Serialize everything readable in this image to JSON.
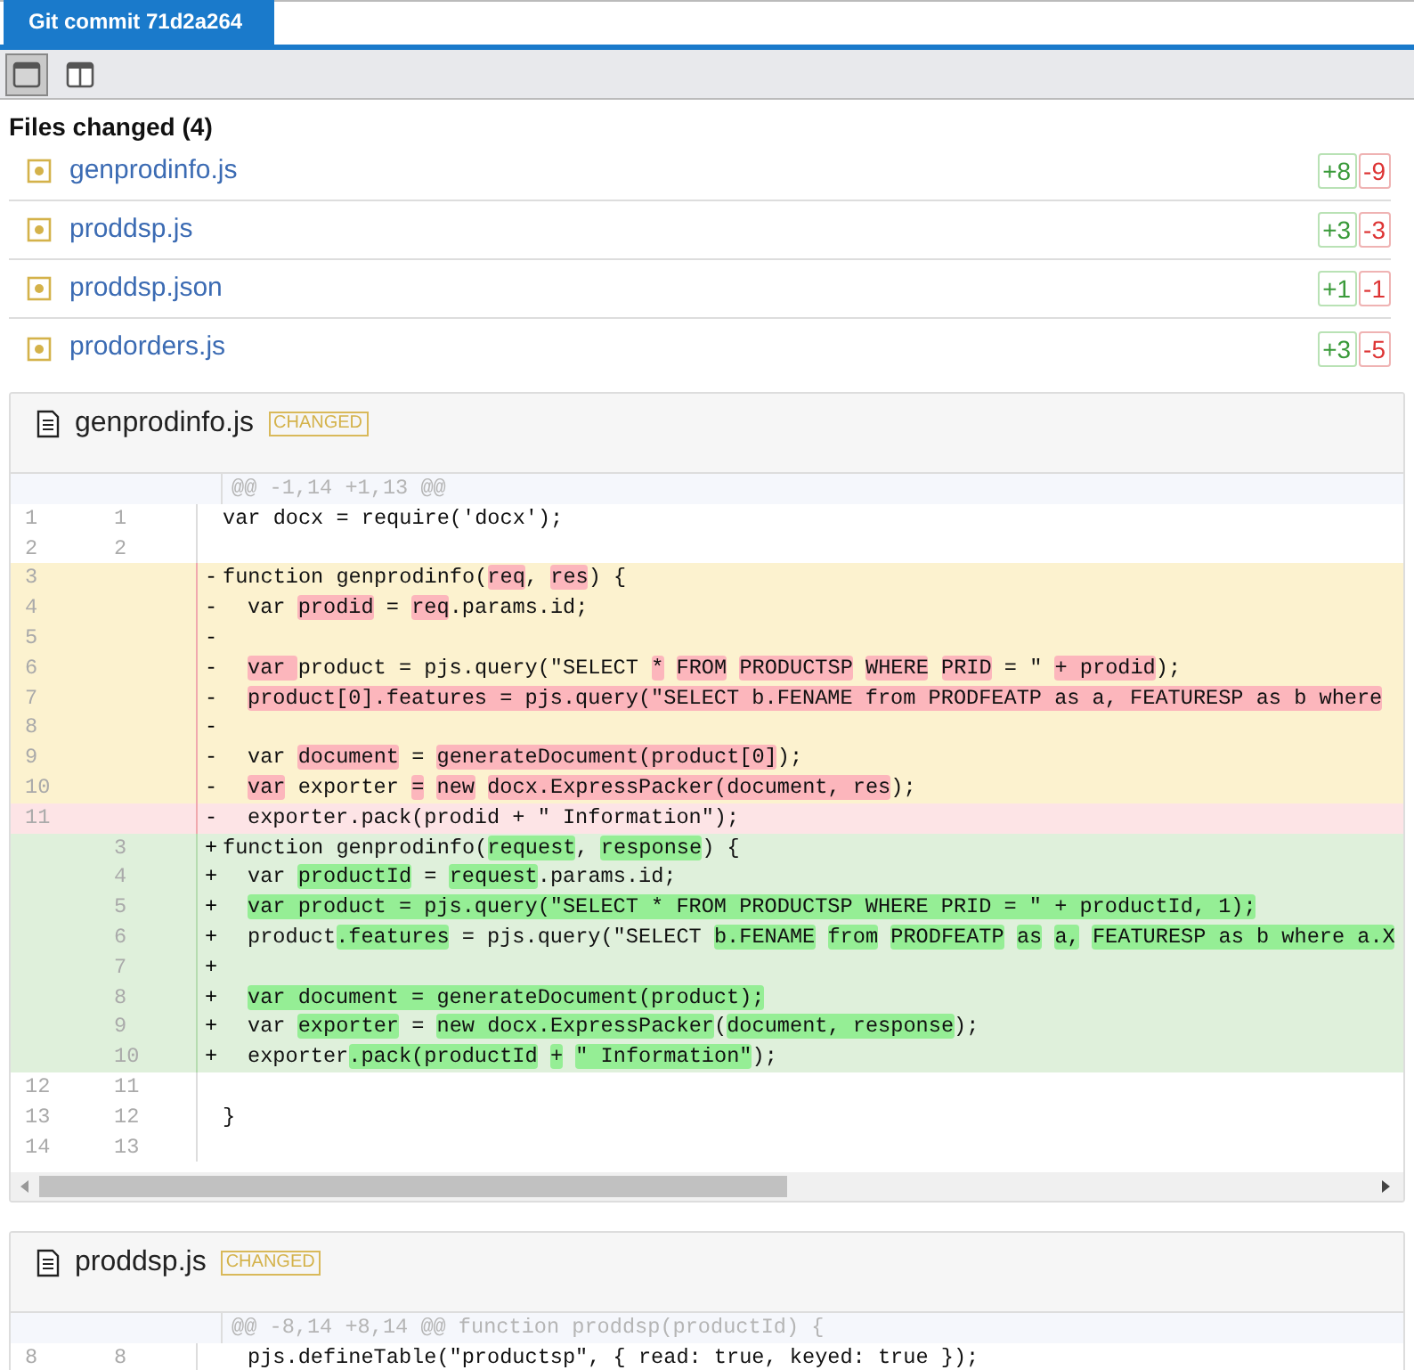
{
  "tab": {
    "label": "Git commit 71d2a264",
    "selected": true
  },
  "view_modes": [
    {
      "kind": "unified",
      "selected": true
    },
    {
      "kind": "split",
      "selected": false
    }
  ],
  "files_heading": "Files changed (4)",
  "files": [
    {
      "name": "genprodinfo.js",
      "added": "+8",
      "removed": "-9"
    },
    {
      "name": "proddsp.js",
      "added": "+3",
      "removed": "-3"
    },
    {
      "name": "proddsp.json",
      "added": "+1",
      "removed": "-1"
    },
    {
      "name": "prodorders.js",
      "added": "+3",
      "removed": "-5"
    }
  ],
  "diffs": [
    {
      "name": "genprodinfo.js",
      "status": "CHANGED",
      "hunk": "@@ -1,14 +1,13 @@",
      "scrollbar": true,
      "lines": [
        {
          "kind": "context",
          "old": "1",
          "new": "1",
          "code": [
            {
              "t": "var docx = require('docx');",
              "hl": false
            }
          ]
        },
        {
          "kind": "context",
          "old": "2",
          "new": "2"
        },
        {
          "kind": "modified",
          "old": "3",
          "marker": "-",
          "code": [
            {
              "t": "function genprodinfo(",
              "hl": false
            },
            {
              "t": "req",
              "hl": true
            },
            {
              "t": ",",
              "hl": false,
              "sp": true
            },
            {
              "t": "res",
              "hl": true
            },
            {
              "t": ") {",
              "hl": false
            }
          ]
        },
        {
          "kind": "modified",
          "old": "4",
          "marker": "-",
          "indented": true,
          "code": [
            {
              "t": "var",
              "hl": false,
              "sp": true
            },
            {
              "t": "prodid",
              "hl": true
            },
            {
              "t": " =",
              "hl": false,
              "sp": true
            },
            {
              "t": "req",
              "hl": true
            },
            {
              "t": ".params.id;",
              "hl": false
            }
          ]
        },
        {
          "kind": "modified",
          "old": "5",
          "marker": "-"
        },
        {
          "kind": "modified",
          "old": "6",
          "marker": "-",
          "indented": true,
          "code": [
            {
              "t": "var ",
              "hl": true
            },
            {
              "t": "product = pjs.query(\"SELECT",
              "hl": false,
              "sp": true
            },
            {
              "t": "*",
              "hl": true,
              "sp": true
            },
            {
              "t": "FROM",
              "hl": true,
              "sp": true
            },
            {
              "t": "PRODUCTSP",
              "hl": true,
              "sp": true
            },
            {
              "t": "WHERE",
              "hl": true,
              "sp": true
            },
            {
              "t": "PRID",
              "hl": true
            },
            {
              "t": " = \"",
              "hl": false,
              "sp": true
            },
            {
              "t": "+ prodid",
              "hl": true
            },
            {
              "t": ");",
              "hl": false
            }
          ]
        },
        {
          "kind": "modified",
          "old": "7",
          "marker": "-",
          "indented": true,
          "code": [
            {
              "t": "product[0].features = pjs.query(\"SELECT b.FENAME from PRODFEATP as a, FEATURESP as b where",
              "hl": true
            }
          ]
        },
        {
          "kind": "modified",
          "old": "8",
          "marker": "-"
        },
        {
          "kind": "modified",
          "old": "9",
          "marker": "-",
          "indented": true,
          "code": [
            {
              "t": "var",
              "hl": false,
              "sp": true
            },
            {
              "t": "document",
              "hl": true
            },
            {
              "t": " =",
              "hl": false,
              "sp": true
            },
            {
              "t": "generateDocument(product[0]",
              "hl": true
            },
            {
              "t": ");",
              "hl": false
            }
          ]
        },
        {
          "kind": "modified",
          "old": "10",
          "marker": "-",
          "indented": true,
          "code": [
            {
              "t": "var",
              "hl": true
            },
            {
              "t": " exporter",
              "hl": false,
              "sp": true
            },
            {
              "t": "=",
              "hl": true,
              "sp": true
            },
            {
              "t": "new",
              "hl": true,
              "sp": true
            },
            {
              "t": "docx.ExpressPacker(document, res",
              "hl": true
            },
            {
              "t": ");",
              "hl": false
            }
          ]
        },
        {
          "kind": "removed",
          "old": "11",
          "marker": "-",
          "indented": true,
          "code": [
            {
              "t": "exporter.pack(prodid + \" Information\");",
              "hl": false
            }
          ]
        },
        {
          "kind": "added",
          "new": "3",
          "marker": "+",
          "code": [
            {
              "t": "function genprodinfo(",
              "hl": false
            },
            {
              "t": "request",
              "hl": true
            },
            {
              "t": ",",
              "hl": false,
              "sp": true
            },
            {
              "t": "response",
              "hl": true
            },
            {
              "t": ") {",
              "hl": false
            }
          ]
        },
        {
          "kind": "added",
          "new": "4",
          "marker": "+",
          "indented": true,
          "code": [
            {
              "t": "var",
              "hl": false,
              "sp": true
            },
            {
              "t": "productId",
              "hl": true
            },
            {
              "t": " =",
              "hl": false,
              "sp": true
            },
            {
              "t": "request",
              "hl": true
            },
            {
              "t": ".params.id;",
              "hl": false
            }
          ]
        },
        {
          "kind": "added",
          "new": "5",
          "marker": "+",
          "indented": true,
          "code": [
            {
              "t": "var product = pjs.query(\"SELECT * FROM PRODUCTSP WHERE PRID = \" + productId, 1);",
              "hl": true
            }
          ]
        },
        {
          "kind": "added",
          "new": "6",
          "marker": "+",
          "indented": true,
          "code": [
            {
              "t": "product",
              "hl": false
            },
            {
              "t": ".features",
              "hl": true
            },
            {
              "t": " = pjs.query(\"SELECT",
              "hl": false,
              "sp": true
            },
            {
              "t": "b.FENAME",
              "hl": true,
              "sp": true
            },
            {
              "t": "from",
              "hl": true,
              "sp": true
            },
            {
              "t": "PRODFEATP",
              "hl": true,
              "sp": true
            },
            {
              "t": "as",
              "hl": true,
              "sp": true
            },
            {
              "t": "a,",
              "hl": true,
              "sp": true
            },
            {
              "t": "FEATURESP as b where a.X",
              "hl": true
            }
          ]
        },
        {
          "kind": "added",
          "new": "7",
          "marker": "+"
        },
        {
          "kind": "added",
          "new": "8",
          "marker": "+",
          "indented": true,
          "code": [
            {
              "t": "var document = generateDocument(product);",
              "hl": true
            }
          ]
        },
        {
          "kind": "added",
          "new": "9",
          "marker": "+",
          "indented": true,
          "code": [
            {
              "t": "var",
              "hl": false,
              "sp": true
            },
            {
              "t": "exporter",
              "hl": true
            },
            {
              "t": " =",
              "hl": false,
              "sp": true
            },
            {
              "t": "new docx.ExpressPacker",
              "hl": true
            },
            {
              "t": "(",
              "hl": false
            },
            {
              "t": "document, response",
              "hl": true
            },
            {
              "t": ");",
              "hl": false
            }
          ]
        },
        {
          "kind": "added",
          "new": "10",
          "marker": "+",
          "indented": true,
          "code": [
            {
              "t": "exporter",
              "hl": false
            },
            {
              "t": ".pack(productId",
              "hl": true,
              "sp": true
            },
            {
              "t": "+",
              "hl": true,
              "sp": true
            },
            {
              "t": "\" Information\"",
              "hl": true
            },
            {
              "t": ");",
              "hl": false
            }
          ]
        },
        {
          "kind": "context",
          "old": "12",
          "new": "11"
        },
        {
          "kind": "context",
          "old": "13",
          "new": "12",
          "code": [
            {
              "t": "}",
              "hl": false
            }
          ]
        },
        {
          "kind": "context",
          "old": "14",
          "new": "13"
        }
      ]
    },
    {
      "name": "proddsp.js",
      "status": "CHANGED",
      "hunk": "@@ -8,14 +8,14 @@ function proddsp(productId) {",
      "lines": [
        {
          "kind": "context",
          "old": "8",
          "new": "8",
          "indented": true,
          "code": [
            {
              "t": "pjs.defineTable(\"productsp\", { read: true, keyed: true });",
              "hl": false
            }
          ]
        }
      ]
    }
  ]
}
